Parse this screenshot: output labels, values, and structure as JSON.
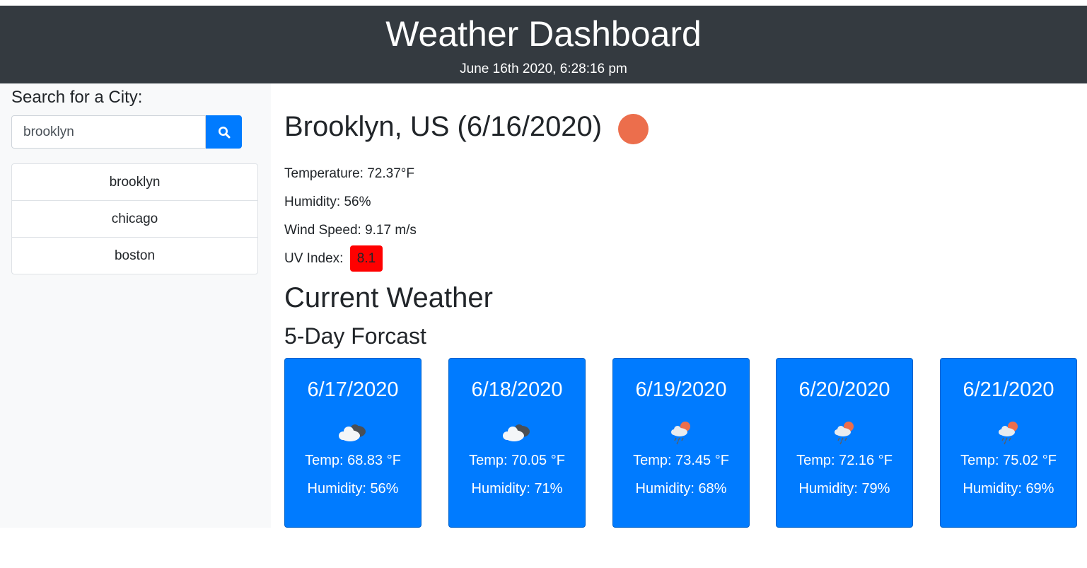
{
  "header": {
    "title": "Weather Dashboard",
    "datetime": "June 16th 2020, 6:28:16 pm"
  },
  "sidebar": {
    "search_label": "Search for a City:",
    "search_value": "brooklyn",
    "search_button_icon": "search-icon",
    "history": [
      "brooklyn",
      "chicago",
      "boston"
    ]
  },
  "current": {
    "heading": "Brooklyn, US (6/16/2020)",
    "icon": "sun-icon",
    "temperature": "Temperature: 72.37°F",
    "humidity": "Humidity: 56%",
    "wind": "Wind Speed: 9.17 m/s",
    "uv_label": "UV Index:",
    "uv_value": "8.1",
    "uv_color": "#ff0000"
  },
  "sections": {
    "current_weather": "Current Weather",
    "forecast": "5-Day Forcast"
  },
  "forecast": [
    {
      "date": "6/17/2020",
      "icon": "broken-clouds-icon",
      "temp": "Temp: 68.83 °F",
      "humidity": "Humidity: 56%"
    },
    {
      "date": "6/18/2020",
      "icon": "broken-clouds-icon",
      "temp": "Temp: 70.05 °F",
      "humidity": "Humidity: 71%"
    },
    {
      "date": "6/19/2020",
      "icon": "rain-sun-icon",
      "temp": "Temp: 73.45 °F",
      "humidity": "Humidity: 68%"
    },
    {
      "date": "6/20/2020",
      "icon": "rain-sun-icon",
      "temp": "Temp: 72.16 °F",
      "humidity": "Humidity: 79%"
    },
    {
      "date": "6/21/2020",
      "icon": "rain-sun-icon",
      "temp": "Temp: 75.02 °F",
      "humidity": "Humidity: 69%"
    }
  ],
  "colors": {
    "header_bg": "#343a40",
    "accent": "#007bff",
    "sidebar_bg": "#f8f9fa",
    "sun": "#ec6e4c"
  }
}
